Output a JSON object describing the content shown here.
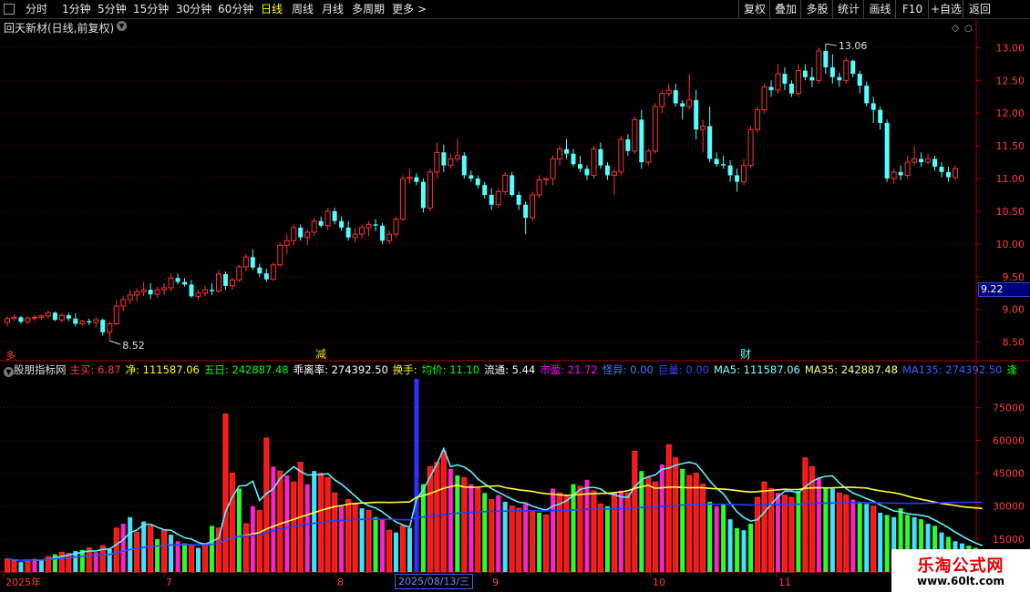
{
  "toolbar": {
    "left": [
      "分时",
      "1分钟",
      "5分钟",
      "15分钟",
      "30分钟",
      "60分钟",
      "日线",
      "周线",
      "月线",
      "多周期",
      "更多 >"
    ],
    "active": "日线",
    "right": [
      "复权",
      "叠加",
      "多股",
      "统计",
      "画线",
      "F10",
      "+自选",
      "返回"
    ]
  },
  "stock": {
    "title": "回天新材(日线,前复权)"
  },
  "price_panel": {
    "y_ticks": [
      "13.00",
      "12.50",
      "12.00",
      "11.50",
      "11.00",
      "10.50",
      "10.00",
      "9.50",
      "9.00",
      "8.50"
    ],
    "high_label": "13.06",
    "low_label": "8.52",
    "current_tag": "9.22",
    "markers": [
      "减",
      "财"
    ],
    "left_marker": "多"
  },
  "indicator": {
    "name": "股朋指标网",
    "items": [
      {
        "label": "主买:",
        "value": "6.87",
        "color": "#ff3b3b"
      },
      {
        "label": "净:",
        "value": "111587.06",
        "color": "#ffff00"
      },
      {
        "label": "五日:",
        "value": "242887.48",
        "color": "#00ff00"
      },
      {
        "label": "乖离率:",
        "value": "274392.50",
        "color": "#ffffff"
      },
      {
        "label": "换手:",
        "value": "",
        "color": "#ffff00"
      },
      {
        "label": "均价:",
        "value": "11.10",
        "color": "#00ff00"
      },
      {
        "label": "流通:",
        "value": "5.44",
        "color": "#ffffff"
      },
      {
        "label": "市盈:",
        "value": "21.72",
        "color": "#ff00ff"
      },
      {
        "label": "怪异:",
        "value": "0.00",
        "color": "#4080ff"
      },
      {
        "label": "巨量:",
        "value": "0.00",
        "color": "#4040ff"
      },
      {
        "label": "MA5:",
        "value": "111587.06",
        "color": "#7fffff"
      },
      {
        "label": "MA35:",
        "value": "242887.48",
        "color": "#ffff80"
      },
      {
        "label": "MA135:",
        "value": "274392.50",
        "color": "#3060ff"
      },
      {
        "label": "逢",
        "value": "",
        "color": "#00ff00"
      }
    ],
    "y_ticks": [
      "75000",
      "60000",
      "45000",
      "30000",
      "15000"
    ]
  },
  "date_axis": {
    "labels": [
      "2025年",
      "7",
      "8",
      "9",
      "10",
      "11"
    ],
    "selected_date": "2025/08/13/三"
  },
  "watermark": {
    "line1": "乐淘公式网",
    "line2": "www.60lt.com"
  },
  "chart_data": {
    "type": "candlestick",
    "title": "回天新材(日线,前复权)",
    "price_axis": {
      "ylim": [
        8.3,
        13.2
      ],
      "ticks": [
        8.5,
        9,
        9.5,
        10,
        10.5,
        11,
        11.5,
        12,
        12.5,
        13
      ]
    },
    "highest": 13.06,
    "lowest": 8.52,
    "ohlc": [
      [
        8.8,
        8.9,
        8.74,
        8.86
      ],
      [
        8.86,
        8.92,
        8.82,
        8.88
      ],
      [
        8.88,
        8.9,
        8.78,
        8.81
      ],
      [
        8.81,
        8.89,
        8.78,
        8.87
      ],
      [
        8.87,
        8.92,
        8.82,
        8.88
      ],
      [
        8.88,
        8.92,
        8.84,
        8.9
      ],
      [
        8.9,
        8.98,
        8.86,
        8.95
      ],
      [
        8.95,
        8.97,
        8.82,
        8.84
      ],
      [
        8.84,
        8.94,
        8.8,
        8.91
      ],
      [
        8.91,
        8.95,
        8.82,
        8.86
      ],
      [
        8.86,
        8.94,
        8.74,
        8.78
      ],
      [
        8.78,
        8.84,
        8.75,
        8.82
      ],
      [
        8.82,
        8.86,
        8.76,
        8.8
      ],
      [
        8.8,
        8.88,
        8.72,
        8.84
      ],
      [
        8.84,
        8.86,
        8.6,
        8.65
      ],
      [
        8.65,
        8.82,
        8.52,
        8.78
      ],
      [
        8.78,
        9.14,
        8.75,
        9.05
      ],
      [
        9.05,
        9.2,
        8.98,
        9.15
      ],
      [
        9.15,
        9.3,
        9.08,
        9.22
      ],
      [
        9.22,
        9.32,
        9.12,
        9.27
      ],
      [
        9.27,
        9.42,
        9.2,
        9.3
      ],
      [
        9.3,
        9.4,
        9.16,
        9.23
      ],
      [
        9.23,
        9.35,
        9.18,
        9.3
      ],
      [
        9.3,
        9.4,
        9.22,
        9.33
      ],
      [
        9.33,
        9.55,
        9.28,
        9.48
      ],
      [
        9.48,
        9.55,
        9.38,
        9.42
      ],
      [
        9.42,
        9.48,
        9.35,
        9.38
      ],
      [
        9.38,
        9.45,
        9.18,
        9.2
      ],
      [
        9.2,
        9.3,
        9.14,
        9.25
      ],
      [
        9.25,
        9.36,
        9.2,
        9.3
      ],
      [
        9.3,
        9.4,
        9.22,
        9.28
      ],
      [
        9.28,
        9.6,
        9.25,
        9.54
      ],
      [
        9.54,
        9.58,
        9.3,
        9.36
      ],
      [
        9.36,
        9.48,
        9.3,
        9.45
      ],
      [
        9.45,
        9.68,
        9.42,
        9.65
      ],
      [
        9.65,
        9.85,
        9.58,
        9.8
      ],
      [
        9.8,
        9.92,
        9.6,
        9.64
      ],
      [
        9.64,
        9.7,
        9.5,
        9.55
      ],
      [
        9.55,
        9.62,
        9.42,
        9.46
      ],
      [
        9.46,
        9.72,
        9.44,
        9.68
      ],
      [
        9.68,
        10.02,
        9.65,
        9.98
      ],
      [
        9.98,
        10.15,
        9.85,
        10.05
      ],
      [
        10.05,
        10.3,
        9.98,
        10.25
      ],
      [
        10.25,
        10.3,
        10.05,
        10.1
      ],
      [
        10.1,
        10.22,
        9.98,
        10.18
      ],
      [
        10.18,
        10.4,
        10.12,
        10.35
      ],
      [
        10.35,
        10.42,
        10.25,
        10.28
      ],
      [
        10.28,
        10.55,
        10.22,
        10.5
      ],
      [
        10.5,
        10.55,
        10.3,
        10.35
      ],
      [
        10.35,
        10.42,
        10.2,
        10.25
      ],
      [
        10.25,
        10.35,
        10.05,
        10.1
      ],
      [
        10.1,
        10.25,
        10.02,
        10.15
      ],
      [
        10.15,
        10.3,
        10.08,
        10.25
      ],
      [
        10.25,
        10.35,
        10.12,
        10.3
      ],
      [
        10.3,
        10.38,
        10.2,
        10.28
      ],
      [
        10.28,
        10.32,
        10.0,
        10.05
      ],
      [
        10.05,
        10.2,
        10.0,
        10.15
      ],
      [
        10.15,
        10.42,
        10.1,
        10.38
      ],
      [
        10.38,
        11.05,
        10.35,
        11.0
      ],
      [
        11.0,
        11.15,
        10.92,
        11.02
      ],
      [
        11.02,
        11.08,
        10.9,
        10.95
      ],
      [
        10.95,
        11.0,
        10.48,
        10.55
      ],
      [
        10.55,
        11.15,
        10.5,
        11.1
      ],
      [
        11.1,
        11.55,
        11.0,
        11.4
      ],
      [
        11.4,
        11.52,
        11.1,
        11.2
      ],
      [
        11.2,
        11.38,
        11.15,
        11.3
      ],
      [
        11.3,
        11.6,
        11.25,
        11.35
      ],
      [
        11.35,
        11.4,
        11.0,
        11.05
      ],
      [
        11.05,
        11.12,
        10.95,
        11.0
      ],
      [
        11.0,
        11.05,
        10.85,
        10.9
      ],
      [
        10.9,
        10.95,
        10.7,
        10.75
      ],
      [
        10.75,
        10.85,
        10.52,
        10.6
      ],
      [
        10.6,
        10.85,
        10.55,
        10.8
      ],
      [
        10.8,
        11.1,
        10.75,
        11.05
      ],
      [
        11.05,
        11.1,
        10.72,
        10.75
      ],
      [
        10.75,
        10.8,
        10.52,
        10.6
      ],
      [
        10.6,
        10.65,
        10.15,
        10.4
      ],
      [
        10.4,
        10.8,
        10.35,
        10.75
      ],
      [
        10.75,
        11.05,
        10.7,
        10.98
      ],
      [
        10.98,
        11.02,
        10.9,
        11.0
      ],
      [
        11.0,
        11.35,
        10.9,
        11.3
      ],
      [
        11.3,
        11.5,
        11.2,
        11.45
      ],
      [
        11.45,
        11.6,
        11.3,
        11.38
      ],
      [
        11.38,
        11.45,
        11.18,
        11.22
      ],
      [
        11.22,
        11.35,
        11.1,
        11.15
      ],
      [
        11.15,
        11.2,
        10.98,
        11.05
      ],
      [
        11.05,
        11.5,
        11.0,
        11.45
      ],
      [
        11.45,
        11.55,
        11.15,
        11.2
      ],
      [
        11.2,
        11.25,
        10.98,
        11.05
      ],
      [
        11.05,
        11.15,
        10.75,
        11.1
      ],
      [
        11.1,
        11.65,
        11.05,
        11.6
      ],
      [
        11.6,
        11.68,
        11.35,
        11.42
      ],
      [
        11.42,
        11.95,
        11.38,
        11.9
      ],
      [
        11.9,
        12.05,
        11.15,
        11.25
      ],
      [
        11.25,
        11.45,
        11.2,
        11.42
      ],
      [
        11.42,
        12.15,
        11.38,
        12.1
      ],
      [
        12.1,
        12.35,
        12.0,
        12.3
      ],
      [
        12.3,
        12.45,
        12.25,
        12.35
      ],
      [
        12.35,
        12.45,
        12.1,
        12.15
      ],
      [
        12.15,
        12.2,
        11.9,
        12.1
      ],
      [
        12.1,
        12.6,
        12.05,
        12.2
      ],
      [
        12.2,
        12.35,
        11.6,
        11.75
      ],
      [
        11.75,
        11.9,
        11.4,
        11.8
      ],
      [
        11.8,
        12.1,
        11.25,
        11.3
      ],
      [
        11.3,
        11.4,
        11.18,
        11.22
      ],
      [
        11.22,
        11.35,
        11.15,
        11.2
      ],
      [
        11.2,
        11.28,
        10.95,
        11.05
      ],
      [
        11.05,
        11.15,
        10.8,
        10.95
      ],
      [
        10.95,
        11.3,
        10.9,
        11.2
      ],
      [
        11.2,
        11.8,
        11.15,
        11.75
      ],
      [
        11.75,
        12.1,
        11.7,
        12.05
      ],
      [
        12.05,
        12.45,
        12.0,
        12.4
      ],
      [
        12.4,
        12.5,
        12.25,
        12.35
      ],
      [
        12.35,
        12.75,
        12.3,
        12.6
      ],
      [
        12.6,
        12.7,
        12.35,
        12.45
      ],
      [
        12.45,
        12.5,
        12.25,
        12.3
      ],
      [
        12.3,
        12.75,
        12.25,
        12.65
      ],
      [
        12.65,
        12.75,
        12.5,
        12.55
      ],
      [
        12.55,
        12.7,
        12.4,
        12.5
      ],
      [
        12.5,
        13.0,
        12.45,
        12.95
      ],
      [
        12.95,
        13.06,
        12.6,
        12.7
      ],
      [
        12.7,
        12.9,
        12.45,
        12.55
      ],
      [
        12.55,
        12.62,
        12.4,
        12.5
      ],
      [
        12.5,
        12.85,
        12.45,
        12.8
      ],
      [
        12.8,
        12.82,
        12.55,
        12.6
      ],
      [
        12.6,
        12.65,
        12.3,
        12.42
      ],
      [
        12.42,
        12.48,
        12.1,
        12.15
      ],
      [
        12.15,
        12.25,
        11.85,
        12.05
      ],
      [
        12.05,
        12.1,
        11.75,
        11.85
      ],
      [
        11.85,
        11.9,
        10.95,
        11.0
      ],
      [
        11.0,
        11.15,
        10.92,
        11.1
      ],
      [
        11.1,
        11.2,
        10.98,
        11.05
      ],
      [
        11.05,
        11.35,
        11.0,
        11.25
      ],
      [
        11.25,
        11.5,
        11.2,
        11.3
      ],
      [
        11.3,
        11.4,
        11.18,
        11.25
      ],
      [
        11.25,
        11.38,
        11.22,
        11.3
      ],
      [
        11.3,
        11.35,
        11.12,
        11.18
      ],
      [
        11.18,
        11.25,
        11.02,
        11.1
      ],
      [
        11.1,
        11.18,
        10.95,
        11.02
      ],
      [
        11.02,
        11.2,
        10.98,
        11.15
      ]
    ],
    "volume_axis": {
      "ylim": [
        0,
        88000
      ],
      "ticks": [
        15000,
        30000,
        45000,
        60000,
        75000
      ]
    },
    "volume": [
      6000,
      5000,
      4500,
      5500,
      6000,
      5800,
      7000,
      8000,
      9000,
      8500,
      9500,
      10000,
      11000,
      9000,
      12000,
      10500,
      20000,
      22000,
      25000,
      18000,
      23000,
      21000,
      15000,
      19000,
      17000,
      14000,
      13000,
      12000,
      11000,
      13000,
      21000,
      20000,
      72000,
      45000,
      38000,
      22000,
      30000,
      28000,
      61000,
      48000,
      46000,
      44000,
      41000,
      50000,
      40000,
      46000,
      45000,
      43000,
      36000,
      30000,
      33000,
      31000,
      29000,
      28000,
      25000,
      24000,
      19000,
      18000,
      21000,
      20000,
      88000,
      40000,
      48000,
      50000,
      55000,
      47000,
      44000,
      43000,
      40000,
      38000,
      36000,
      33000,
      35000,
      32000,
      30000,
      29000,
      31000,
      28000,
      27000,
      26000,
      38000,
      36000,
      35000,
      40000,
      39000,
      42000,
      37000,
      31000,
      30000,
      36000,
      37000,
      36000,
      55000,
      46000,
      43000,
      41000,
      49000,
      58000,
      52000,
      47000,
      44000,
      45000,
      40000,
      32000,
      30000,
      31000,
      24000,
      20000,
      19000,
      22000,
      34000,
      41000,
      38000,
      36000,
      35000,
      34000,
      37000,
      52000,
      48000,
      43000,
      38000,
      38000,
      36000,
      35000,
      33000,
      32000,
      31000,
      30000,
      27000,
      26000,
      25000,
      29000,
      26000,
      25000,
      24000,
      22000,
      21000,
      18000,
      16000,
      14000,
      13000,
      12000,
      11000,
      10000
    ],
    "volume_colors": [
      "r",
      "r",
      "c",
      "r",
      "m",
      "c",
      "r",
      "g",
      "r",
      "r",
      "c",
      "g",
      "r",
      "m",
      "r",
      "c",
      "r",
      "m",
      "c",
      "r",
      "c",
      "r",
      "g",
      "r",
      "c",
      "m",
      "g",
      "r",
      "c",
      "r",
      "g",
      "r",
      "r",
      "r",
      "g",
      "r",
      "m",
      "r",
      "r",
      "m",
      "r",
      "m",
      "r",
      "r",
      "m",
      "c",
      "r",
      "r",
      "r",
      "m",
      "r",
      "r",
      "c",
      "r",
      "g",
      "m",
      "r",
      "c",
      "r",
      "c",
      "b",
      "g",
      "r",
      "r",
      "r",
      "m",
      "g",
      "r",
      "m",
      "r",
      "g",
      "r",
      "m",
      "c",
      "r",
      "r",
      "m",
      "r",
      "g",
      "r",
      "m",
      "r",
      "r",
      "g",
      "r",
      "m",
      "r",
      "r",
      "g",
      "r",
      "m",
      "r",
      "r",
      "g",
      "r",
      "r",
      "m",
      "r",
      "r",
      "g",
      "r",
      "r",
      "r",
      "g",
      "m",
      "g",
      "c",
      "g",
      "c",
      "g",
      "r",
      "r",
      "r",
      "m",
      "r",
      "r",
      "g",
      "r",
      "r",
      "m",
      "g",
      "c",
      "r",
      "r",
      "m",
      "g",
      "c",
      "r",
      "c",
      "g",
      "c",
      "g",
      "g",
      "c",
      "g",
      "c",
      "g",
      "c",
      "g",
      "c",
      "c",
      "g",
      "g",
      "g"
    ],
    "ma_legend": [
      "MA5",
      "MA35",
      "MA135"
    ]
  }
}
